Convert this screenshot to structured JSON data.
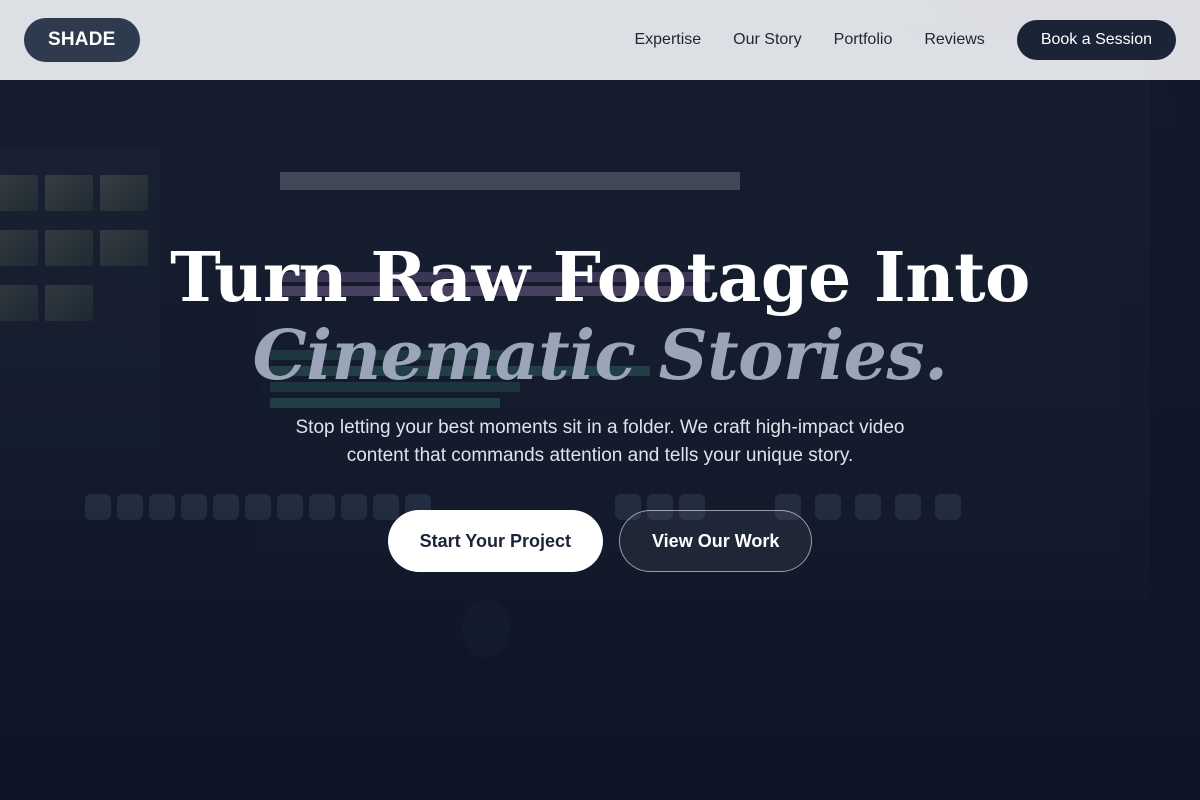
{
  "header": {
    "logo": "SHADE",
    "nav": [
      {
        "label": "Expertise"
      },
      {
        "label": "Our Story"
      },
      {
        "label": "Portfolio"
      },
      {
        "label": "Reviews"
      }
    ],
    "cta_label": "Book a Session"
  },
  "hero": {
    "headline_line1": "Turn Raw Footage Into",
    "headline_line2": "Cinematic Stories.",
    "subtext": "Stop letting your best moments sit in a folder. We craft high-impact video content that commands attention and tells your unique story.",
    "primary_button": "Start Your Project",
    "secondary_button": "View Our Work"
  },
  "colors": {
    "brand_dark": "#1b2337",
    "accent_muted": "#9aa5ba",
    "header_bg": "#eceef2"
  }
}
